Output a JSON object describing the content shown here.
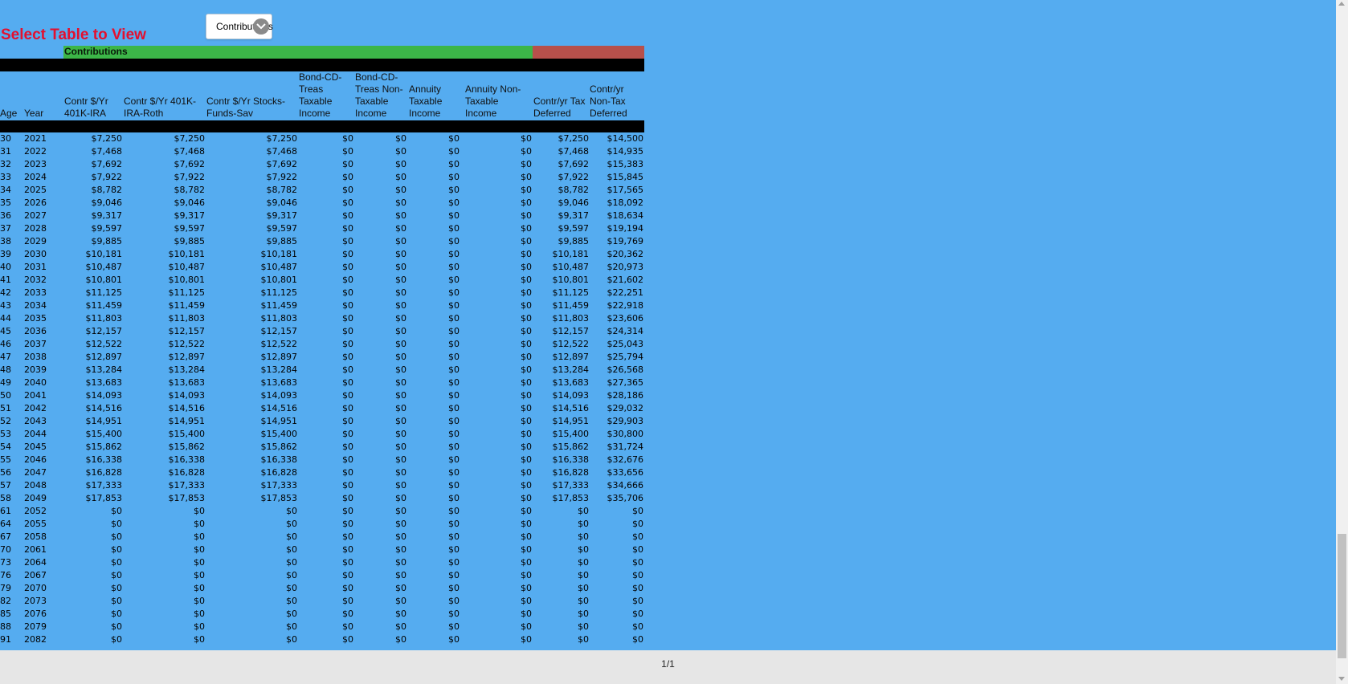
{
  "title": "Select Table to View",
  "selector": {
    "value": "Contributions",
    "icon": "chevron-down-icon"
  },
  "section_label": "Contributions",
  "colors": {
    "background": "#55acf0",
    "title": "#e3102f",
    "band_green": "#3cb648",
    "band_red": "#b7504b"
  },
  "headers": [
    "Age",
    "Year",
    "Contr $/Yr 401K-IRA",
    "Contr $/Yr 401K-IRA-Roth",
    "Contr $/Yr Stocks-Funds-Sav",
    "Bond-CD-Treas Taxable Income",
    "Bond-CD-Treas Non-Taxable Income",
    "Annuity Taxable Income",
    "Annuity Non-Taxable Income",
    "Contr/yr Tax Deferred",
    "Contr/yr Non-Tax Deferred"
  ],
  "rows": [
    [
      "30",
      "2021",
      "$7,250",
      "$7,250",
      "$7,250",
      "$0",
      "$0",
      "$0",
      "$0",
      "$7,250",
      "$14,500"
    ],
    [
      "31",
      "2022",
      "$7,468",
      "$7,468",
      "$7,468",
      "$0",
      "$0",
      "$0",
      "$0",
      "$7,468",
      "$14,935"
    ],
    [
      "32",
      "2023",
      "$7,692",
      "$7,692",
      "$7,692",
      "$0",
      "$0",
      "$0",
      "$0",
      "$7,692",
      "$15,383"
    ],
    [
      "33",
      "2024",
      "$7,922",
      "$7,922",
      "$7,922",
      "$0",
      "$0",
      "$0",
      "$0",
      "$7,922",
      "$15,845"
    ],
    [
      "34",
      "2025",
      "$8,782",
      "$8,782",
      "$8,782",
      "$0",
      "$0",
      "$0",
      "$0",
      "$8,782",
      "$17,565"
    ],
    [
      "35",
      "2026",
      "$9,046",
      "$9,046",
      "$9,046",
      "$0",
      "$0",
      "$0",
      "$0",
      "$9,046",
      "$18,092"
    ],
    [
      "36",
      "2027",
      "$9,317",
      "$9,317",
      "$9,317",
      "$0",
      "$0",
      "$0",
      "$0",
      "$9,317",
      "$18,634"
    ],
    [
      "37",
      "2028",
      "$9,597",
      "$9,597",
      "$9,597",
      "$0",
      "$0",
      "$0",
      "$0",
      "$9,597",
      "$19,194"
    ],
    [
      "38",
      "2029",
      "$9,885",
      "$9,885",
      "$9,885",
      "$0",
      "$0",
      "$0",
      "$0",
      "$9,885",
      "$19,769"
    ],
    [
      "39",
      "2030",
      "$10,181",
      "$10,181",
      "$10,181",
      "$0",
      "$0",
      "$0",
      "$0",
      "$10,181",
      "$20,362"
    ],
    [
      "40",
      "2031",
      "$10,487",
      "$10,487",
      "$10,487",
      "$0",
      "$0",
      "$0",
      "$0",
      "$10,487",
      "$20,973"
    ],
    [
      "41",
      "2032",
      "$10,801",
      "$10,801",
      "$10,801",
      "$0",
      "$0",
      "$0",
      "$0",
      "$10,801",
      "$21,602"
    ],
    [
      "42",
      "2033",
      "$11,125",
      "$11,125",
      "$11,125",
      "$0",
      "$0",
      "$0",
      "$0",
      "$11,125",
      "$22,251"
    ],
    [
      "43",
      "2034",
      "$11,459",
      "$11,459",
      "$11,459",
      "$0",
      "$0",
      "$0",
      "$0",
      "$11,459",
      "$22,918"
    ],
    [
      "44",
      "2035",
      "$11,803",
      "$11,803",
      "$11,803",
      "$0",
      "$0",
      "$0",
      "$0",
      "$11,803",
      "$23,606"
    ],
    [
      "45",
      "2036",
      "$12,157",
      "$12,157",
      "$12,157",
      "$0",
      "$0",
      "$0",
      "$0",
      "$12,157",
      "$24,314"
    ],
    [
      "46",
      "2037",
      "$12,522",
      "$12,522",
      "$12,522",
      "$0",
      "$0",
      "$0",
      "$0",
      "$12,522",
      "$25,043"
    ],
    [
      "47",
      "2038",
      "$12,897",
      "$12,897",
      "$12,897",
      "$0",
      "$0",
      "$0",
      "$0",
      "$12,897",
      "$25,794"
    ],
    [
      "48",
      "2039",
      "$13,284",
      "$13,284",
      "$13,284",
      "$0",
      "$0",
      "$0",
      "$0",
      "$13,284",
      "$26,568"
    ],
    [
      "49",
      "2040",
      "$13,683",
      "$13,683",
      "$13,683",
      "$0",
      "$0",
      "$0",
      "$0",
      "$13,683",
      "$27,365"
    ],
    [
      "50",
      "2041",
      "$14,093",
      "$14,093",
      "$14,093",
      "$0",
      "$0",
      "$0",
      "$0",
      "$14,093",
      "$28,186"
    ],
    [
      "51",
      "2042",
      "$14,516",
      "$14,516",
      "$14,516",
      "$0",
      "$0",
      "$0",
      "$0",
      "$14,516",
      "$29,032"
    ],
    [
      "52",
      "2043",
      "$14,951",
      "$14,951",
      "$14,951",
      "$0",
      "$0",
      "$0",
      "$0",
      "$14,951",
      "$29,903"
    ],
    [
      "53",
      "2044",
      "$15,400",
      "$15,400",
      "$15,400",
      "$0",
      "$0",
      "$0",
      "$0",
      "$15,400",
      "$30,800"
    ],
    [
      "54",
      "2045",
      "$15,862",
      "$15,862",
      "$15,862",
      "$0",
      "$0",
      "$0",
      "$0",
      "$15,862",
      "$31,724"
    ],
    [
      "55",
      "2046",
      "$16,338",
      "$16,338",
      "$16,338",
      "$0",
      "$0",
      "$0",
      "$0",
      "$16,338",
      "$32,676"
    ],
    [
      "56",
      "2047",
      "$16,828",
      "$16,828",
      "$16,828",
      "$0",
      "$0",
      "$0",
      "$0",
      "$16,828",
      "$33,656"
    ],
    [
      "57",
      "2048",
      "$17,333",
      "$17,333",
      "$17,333",
      "$0",
      "$0",
      "$0",
      "$0",
      "$17,333",
      "$34,666"
    ],
    [
      "58",
      "2049",
      "$17,853",
      "$17,853",
      "$17,853",
      "$0",
      "$0",
      "$0",
      "$0",
      "$17,853",
      "$35,706"
    ],
    [
      "61",
      "2052",
      "$0",
      "$0",
      "$0",
      "$0",
      "$0",
      "$0",
      "$0",
      "$0",
      "$0"
    ],
    [
      "64",
      "2055",
      "$0",
      "$0",
      "$0",
      "$0",
      "$0",
      "$0",
      "$0",
      "$0",
      "$0"
    ],
    [
      "67",
      "2058",
      "$0",
      "$0",
      "$0",
      "$0",
      "$0",
      "$0",
      "$0",
      "$0",
      "$0"
    ],
    [
      "70",
      "2061",
      "$0",
      "$0",
      "$0",
      "$0",
      "$0",
      "$0",
      "$0",
      "$0",
      "$0"
    ],
    [
      "73",
      "2064",
      "$0",
      "$0",
      "$0",
      "$0",
      "$0",
      "$0",
      "$0",
      "$0",
      "$0"
    ],
    [
      "76",
      "2067",
      "$0",
      "$0",
      "$0",
      "$0",
      "$0",
      "$0",
      "$0",
      "$0",
      "$0"
    ],
    [
      "79",
      "2070",
      "$0",
      "$0",
      "$0",
      "$0",
      "$0",
      "$0",
      "$0",
      "$0",
      "$0"
    ],
    [
      "82",
      "2073",
      "$0",
      "$0",
      "$0",
      "$0",
      "$0",
      "$0",
      "$0",
      "$0",
      "$0"
    ],
    [
      "85",
      "2076",
      "$0",
      "$0",
      "$0",
      "$0",
      "$0",
      "$0",
      "$0",
      "$0",
      "$0"
    ],
    [
      "88",
      "2079",
      "$0",
      "$0",
      "$0",
      "$0",
      "$0",
      "$0",
      "$0",
      "$0",
      "$0"
    ],
    [
      "91",
      "2082",
      "$0",
      "$0",
      "$0",
      "$0",
      "$0",
      "$0",
      "$0",
      "$0",
      "$0"
    ]
  ],
  "pager": "1/1"
}
